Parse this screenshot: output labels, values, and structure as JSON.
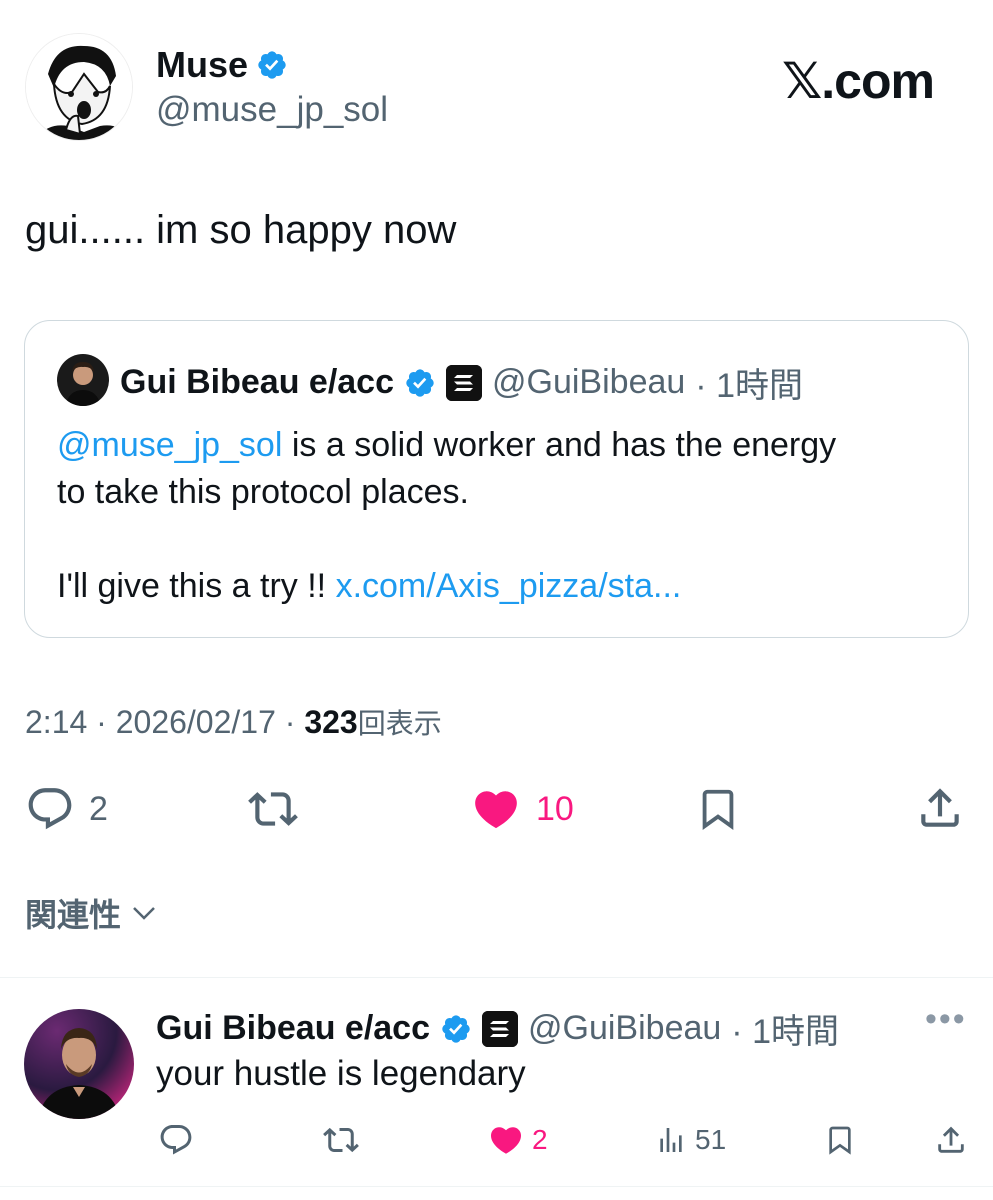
{
  "author": {
    "name": "Muse",
    "handle": "@muse_jp_sol",
    "verified": true
  },
  "brand": "𝕏.com",
  "tweet": {
    "text": "gui...... im so happy now"
  },
  "quote": {
    "name": "Gui Bibeau e/acc",
    "handle": "@GuiBibeau",
    "time": "· 1時間",
    "mention": "@muse_jp_sol",
    "line1_rest": " is a solid worker and has the energy",
    "line2": "to take this protocol places.",
    "line3_text": "I'll give this a try !! ",
    "line3_link": "x.com/Axis_pizza/sta..."
  },
  "meta": {
    "time": "2:14",
    "sep1": " · ",
    "date": "2026/02/17",
    "sep2": " · ",
    "views_count": "323",
    "views_label": "回表示"
  },
  "actions": {
    "reply_count": "2",
    "like_count": "10"
  },
  "sort": {
    "label": "関連性"
  },
  "reply": {
    "name": "Gui Bibeau e/acc",
    "handle": "@GuiBibeau",
    "time": "· 1時間",
    "more": "•••",
    "text": "your hustle is legendary",
    "like_count": "2",
    "views_count": "51"
  },
  "colors": {
    "accent": "#1d9bf0",
    "like": "#f91880",
    "text": "#0f1419",
    "muted": "#536471"
  }
}
